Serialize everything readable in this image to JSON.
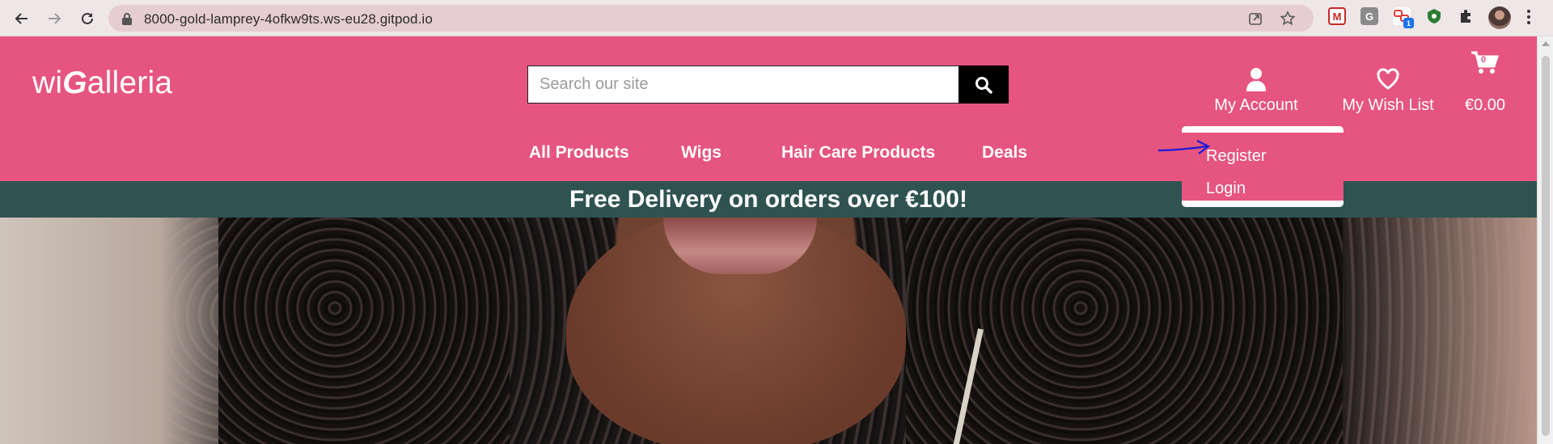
{
  "browser": {
    "url": "8000-gold-lamprey-4ofkw9ts.ws-eu28.gitpod.io",
    "extensions": [
      {
        "name": "mcafee-extension-icon",
        "color": "#c62828",
        "label": "M"
      },
      {
        "name": "grammarly-g-extension-icon",
        "color": "#8a8a8a",
        "label": "G"
      },
      {
        "name": "link-extension-icon",
        "color": "#e53935",
        "label": "",
        "badge": "1"
      },
      {
        "name": "shield-extension-icon",
        "color": "#2e7d32",
        "label": ""
      },
      {
        "name": "puzzle-extensions-icon",
        "color": "#333333",
        "label": ""
      }
    ]
  },
  "site": {
    "logo_prefix": "wi",
    "logo_g": "G",
    "logo_suffix": "alleria",
    "search_placeholder": "Search our site",
    "account_label": "My Account",
    "wishlist_label": "My Wish List",
    "cart_total": "€0.00",
    "cart_count": "0",
    "nav": [
      "All Products",
      "Wigs",
      "Hair Care Products",
      "Deals"
    ],
    "dropdown": [
      "Register",
      "Login"
    ],
    "banner": "Free Delivery on orders over €100!"
  },
  "colors": {
    "brand_pink": "#e65480",
    "banner_teal": "#2f5351",
    "annotation_arrow": "#1a1ad6"
  }
}
